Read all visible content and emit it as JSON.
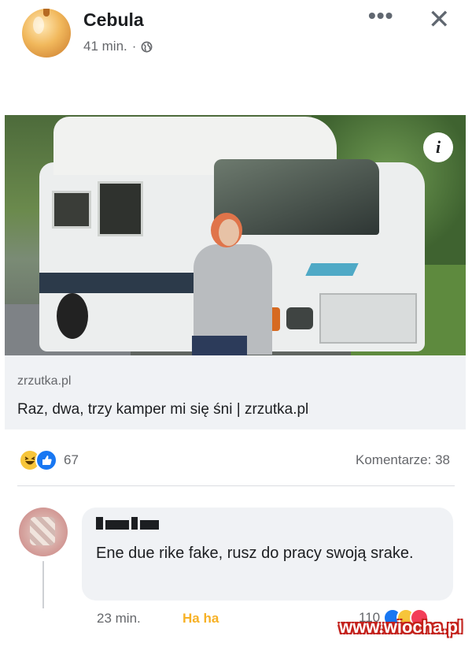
{
  "post": {
    "author": "Cebula",
    "time": "41 min.",
    "separator": "·",
    "privacy_icon": "globe-icon",
    "more_icon": "•••",
    "close_icon": "✕"
  },
  "link": {
    "domain": "zrzutka.pl",
    "title": "Raz, dwa, trzy kamper mi się śni | zrzutka.pl",
    "info_icon": "i"
  },
  "stats": {
    "reaction_icons": [
      "haha-icon",
      "like-icon"
    ],
    "reaction_count": "67",
    "comments": "Komentarze: 38"
  },
  "comment": {
    "text": "Ene due rike fake, rusz do pracy swoją srake.",
    "time": "23 min.",
    "reaction_label": "Ha ha",
    "reaction_count": "110",
    "reaction_icons": [
      "like-icon",
      "haha-icon",
      "love-icon"
    ]
  },
  "watermark": "www.wiocha.pl",
  "colors": {
    "like": "#1877f2",
    "haha": "#f7c53a",
    "love": "#f33e58",
    "link_box": "#f0f2f5",
    "muted_text": "#65676b"
  }
}
